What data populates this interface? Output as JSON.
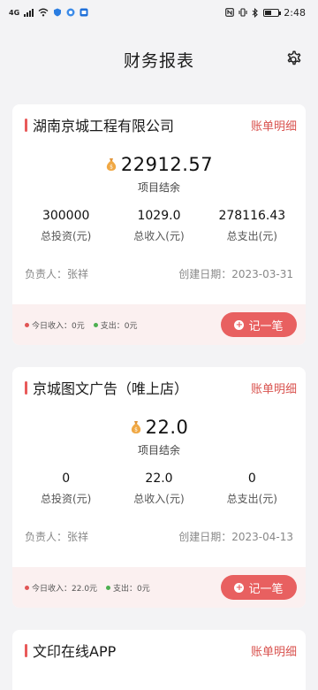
{
  "status_bar": {
    "time": "2:48",
    "network": "4G"
  },
  "header": {
    "title": "财务报表"
  },
  "cards": [
    {
      "name": "湖南京城工程有限公司",
      "detail_label": "账单明细",
      "balance": "22912.57",
      "balance_label": "项目结余",
      "stats": [
        {
          "value": "300000",
          "label": "总投资(元)"
        },
        {
          "value": "1029.0",
          "label": "总收入(元)"
        },
        {
          "value": "278116.43",
          "label": "总支出(元)"
        }
      ],
      "manager": "负责人：张祥",
      "created": "创建日期：2023-03-31",
      "today_income": "今日收入：0元",
      "today_expense": "支出：0元",
      "record_label": "记一笔"
    },
    {
      "name": "京城图文广告（唯上店）",
      "detail_label": "账单明细",
      "balance": "22.0",
      "balance_label": "项目结余",
      "stats": [
        {
          "value": "0",
          "label": "总投资(元)"
        },
        {
          "value": "22.0",
          "label": "总收入(元)"
        },
        {
          "value": "0",
          "label": "总支出(元)"
        }
      ],
      "manager": "负责人：张祥",
      "created": "创建日期：2023-04-13",
      "today_income": "今日收入：22.0元",
      "today_expense": "支出：0元",
      "record_label": "记一笔"
    },
    {
      "name": "文印在线APP",
      "detail_label": "账单明细"
    }
  ],
  "colors": {
    "accent": "#e86060",
    "income_dot": "#e05555",
    "expense_dot": "#4caf50"
  }
}
